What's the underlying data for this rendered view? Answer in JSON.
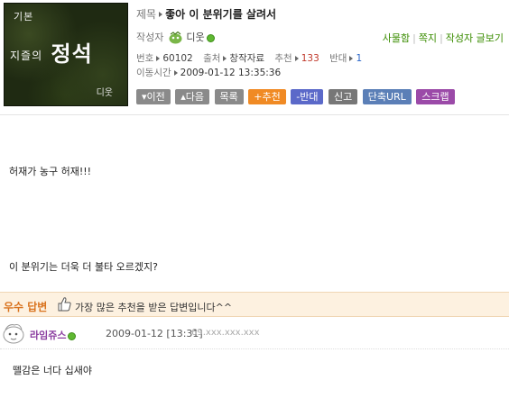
{
  "thumbnail": {
    "small": "기본",
    "big_left": "지즐의",
    "big_right": "정석",
    "sub": "디웃"
  },
  "post": {
    "title_label": "제목",
    "title": "좋아 이 분위기를 살려서",
    "author_label": "작성자",
    "author": "디웃",
    "author_links": [
      "사물함",
      "쪽지",
      "작성자 글보기"
    ],
    "number_label": "번호",
    "number": "60102",
    "source_label": "출처",
    "source": "창작자료",
    "recommend_label": "추천",
    "recommend": "133",
    "oppose_label": "반대",
    "oppose": "1",
    "moved_label": "이동시간",
    "moved_time": "2009-01-12 13:35:36"
  },
  "buttons": {
    "prev": "▾이전",
    "next": "▴다음",
    "list": "목록",
    "recommend": "+추천",
    "oppose": "-반대",
    "report": "신고",
    "short_url": "단축URL",
    "scrap": "스크랩"
  },
  "body": {
    "line1": "허재가 농구 허재!!!",
    "line2": "이 분위기는 더욱 더 불타 오르겠지?"
  },
  "best_answer": {
    "title": "우수 답변",
    "message": "가장 많은 추천을 받은 답변입니다^^"
  },
  "reply": {
    "nick": "라임쥬스",
    "date": "2009-01-12 [13:31]",
    "ip": "69.xxx.xxx.xxx",
    "text": "뗄감은 너다 십새야"
  },
  "colors": {
    "accent_green": "#3a8c00",
    "best_orange": "#d9731e",
    "nick_purple": "#8b3ea0"
  }
}
